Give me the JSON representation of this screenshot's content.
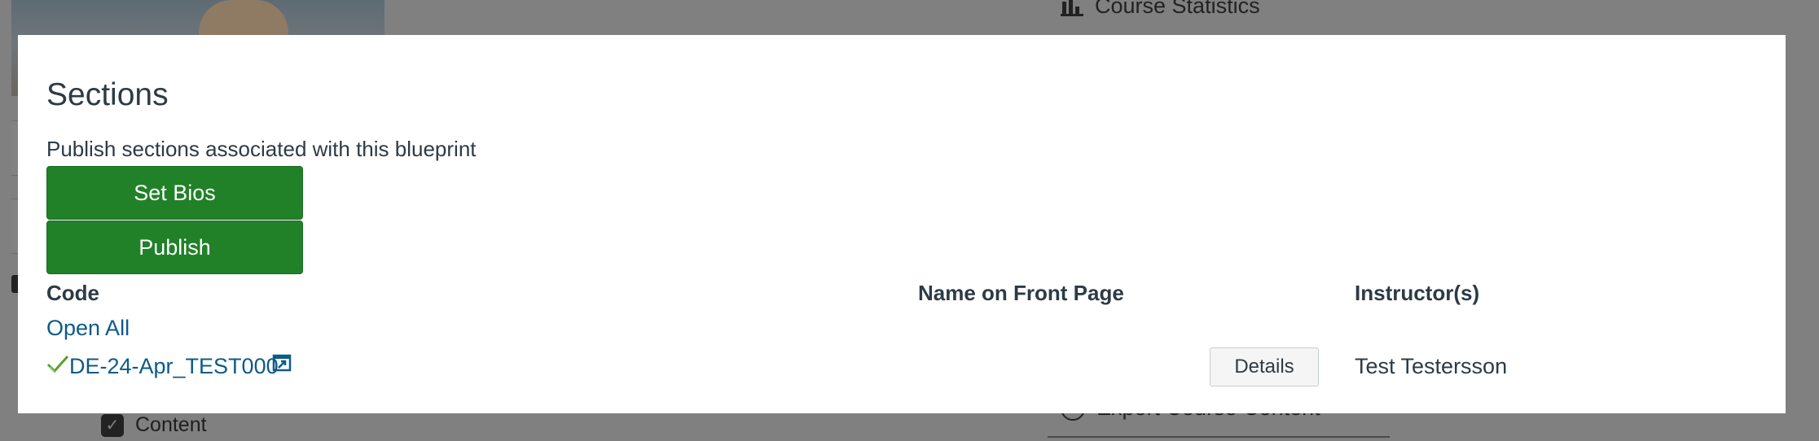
{
  "background": {
    "course_statistics_label": "Course Statistics",
    "content_label": "Content",
    "export_label": "Export Course Content"
  },
  "modal": {
    "title": "Sections",
    "description": "Publish sections associated with this blueprint",
    "set_bios_label": "Set Bios",
    "publish_label": "Publish",
    "columns": {
      "code": "Code",
      "name_on_front_page": "Name on Front Page",
      "instructors": "Instructor(s)"
    },
    "open_all_label": "Open All",
    "rows": [
      {
        "code": "DE-24-Apr_TEST000",
        "name_on_front_page": "",
        "details_label": "Details",
        "instructor": "Test Testersson",
        "status_icon": "checkmark-icon",
        "link_icon": "external-link-icon"
      }
    ]
  },
  "colors": {
    "primary_button": "#218129",
    "link": "#0d5b87",
    "text": "#2d3b45",
    "overlay": "#808080"
  }
}
